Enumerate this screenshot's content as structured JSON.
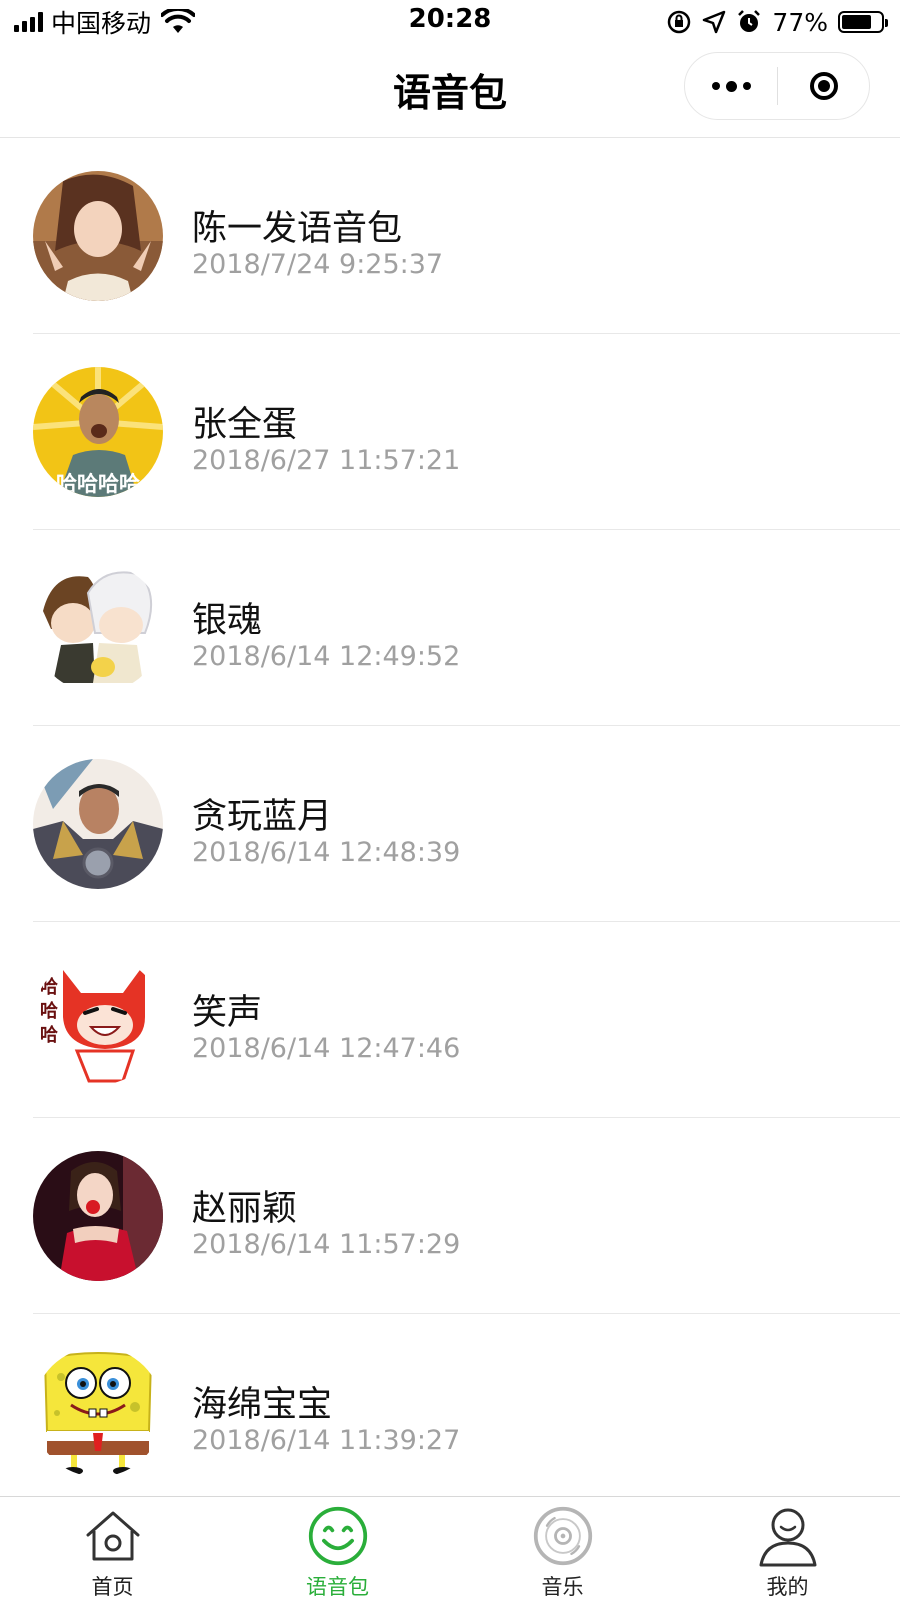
{
  "status_bar": {
    "carrier": "中国移动",
    "time": "20:28",
    "battery_percent": "77%",
    "battery_level": 0.77,
    "icons": [
      "signal-icon",
      "wifi-icon",
      "orientation-lock-icon",
      "location-icon",
      "alarm-icon",
      "battery-icon"
    ]
  },
  "nav": {
    "title": "语音包",
    "icons": [
      "more-icon",
      "close-miniprogram-icon"
    ]
  },
  "voice_packs": [
    {
      "name": "陈一发语音包",
      "time": "2018/7/24 9:25:37"
    },
    {
      "name": "张全蛋",
      "time": "2018/6/27 11:57:21",
      "avatar_text": "哈哈哈哈"
    },
    {
      "name": "银魂",
      "time": "2018/6/14 12:49:52"
    },
    {
      "name": "贪玩蓝月",
      "time": "2018/6/14 12:48:39"
    },
    {
      "name": "笑声",
      "time": "2018/6/14 12:47:46",
      "avatar_text": [
        "哈",
        "哈",
        "哈"
      ]
    },
    {
      "name": "赵丽颖",
      "time": "2018/6/14 11:57:29"
    },
    {
      "name": "海绵宝宝",
      "time": "2018/6/14 11:39:27"
    }
  ],
  "tabs": [
    {
      "label": "首页",
      "icon": "home-icon",
      "active": false
    },
    {
      "label": "语音包",
      "icon": "smile-icon",
      "active": true
    },
    {
      "label": "音乐",
      "icon": "disc-icon",
      "active": false
    },
    {
      "label": "我的",
      "icon": "user-icon",
      "active": false
    }
  ],
  "colors": {
    "accent": "#2aae3a",
    "divider": "#e8e8e8",
    "secondary_text": "#a0a0a0"
  }
}
